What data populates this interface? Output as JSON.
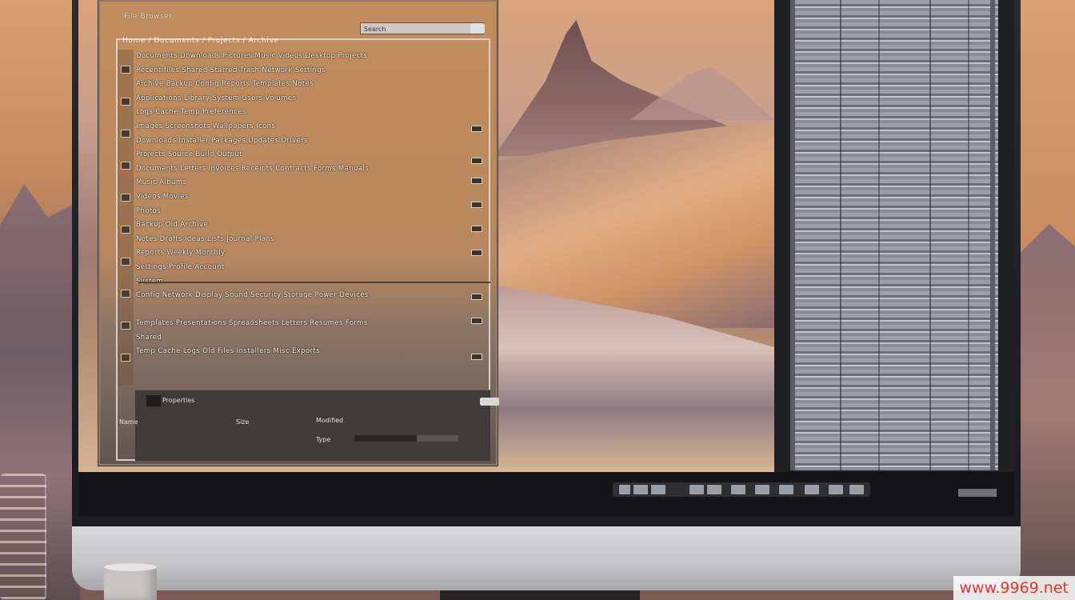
{
  "window": {
    "title": "File Browser",
    "search_placeholder": "Search",
    "path": "Home / Documents / Projects / Archive"
  },
  "rows": [
    "Documents  Downloads  Pictures  Music  Videos  Desktop  Projects",
    "Recent files  Shared  Starred  Trash  Network  Settings",
    "Archive  Backup  Config  Reports  Templates  Notes",
    "Applications  Library  System  Users  Volumes",
    "Logs  Cache  Temp  Preferences",
    "Images  Screenshots  Wallpapers  Icons",
    "Downloads  Installer  Packages  Updates  Drivers",
    "Projects  Source  Build  Output",
    "Documents  Letters  Invoices  Receipts  Contracts  Forms  Manuals",
    "Music  Albums",
    "Videos  Movies",
    "Photos",
    "Backup  Old  Archive",
    "Notes  Drafts  Ideas  Lists  Journal  Plans",
    "Reports  Weekly  Monthly",
    "Settings  Profile  Account",
    "System",
    "Config  Network  Display  Sound  Security  Storage  Power  Devices",
    "",
    "Templates  Presentations  Spreadsheets  Letters  Resumes  Forms",
    "Shared",
    "Temp  Cache  Logs  Old Files  Installers  Misc  Exports"
  ],
  "bottom_panel": {
    "heading": "Properties",
    "cells": [
      "Name",
      "Size",
      "Modified",
      "Type"
    ]
  },
  "watermark": "www.9969.net"
}
